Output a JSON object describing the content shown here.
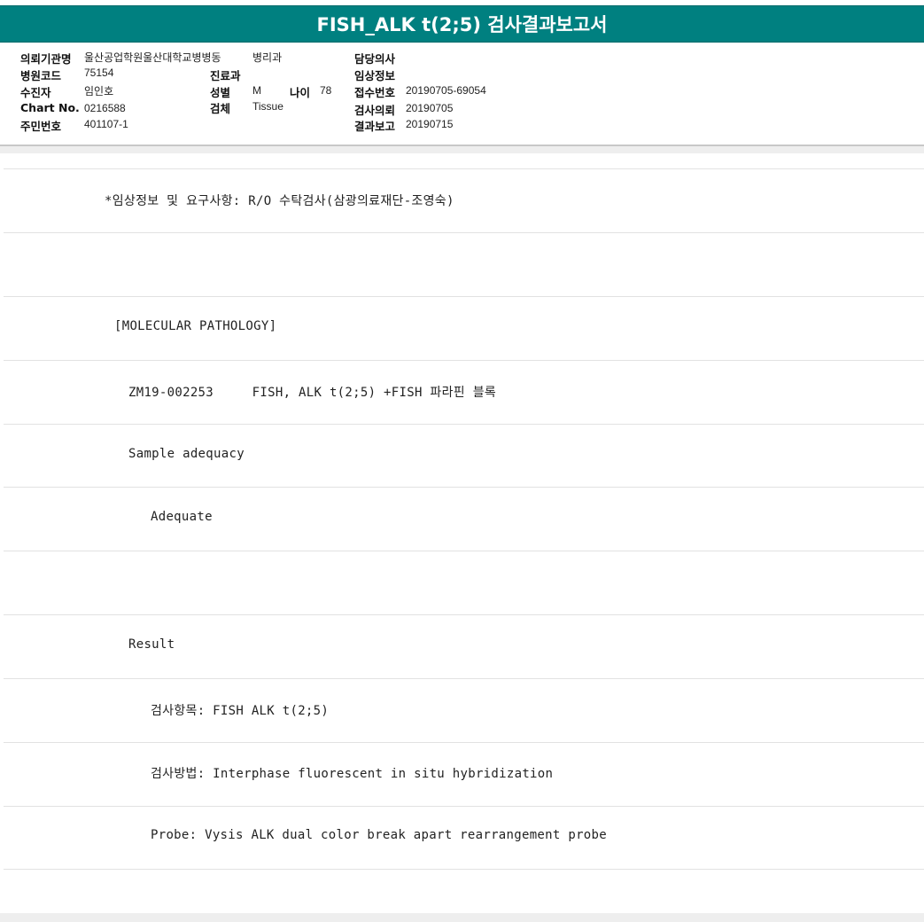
{
  "header": {
    "title": "FISH_ALK t(2;5) 검사결과보고서"
  },
  "info": {
    "requesting_institution_label": "의뢰기관명",
    "requesting_institution": "울산공업학원울산대학교병병동",
    "department": "병리과",
    "doctor_label": "담당의사",
    "doctor": "",
    "hospital_code_label": "병원코드",
    "hospital_code": "75154",
    "clinic_label": "진료과",
    "clinic": "",
    "clinical_info_label": "임상정보",
    "clinical_info": "",
    "patient_label": "수진자",
    "patient": "임인호",
    "sex_label": "성별",
    "sex": "M",
    "age_label": "나이",
    "age": "78",
    "receipt_label": "접수번호",
    "receipt": "20190705-69054",
    "chart_label": "Chart No.",
    "chart": "0216588",
    "specimen_label": "검체",
    "specimen": "Tissue",
    "request_label": "검사의뢰",
    "request": "20190705",
    "resident_label": "주민번호",
    "resident": "401107-1",
    "report_label": "결과보고",
    "report": "20190715"
  },
  "report_lines": [
    "*임상정보 및 요구사항: R/O 수탁검사(삼광의료재단-조영숙)",
    "",
    "[MOLECULAR PATHOLOGY]",
    "ZM19-002253     FISH, ALK t(2;5) +FISH 파라핀 블록",
    "Sample adequacy",
    "Adequate",
    "",
    "Result",
    "검사항목: FISH ALK t(2;5)",
    "검사방법: Interphase fluorescent in situ hybridization",
    "Probe: Vysis ALK dual color break apart rearrangement probe"
  ]
}
